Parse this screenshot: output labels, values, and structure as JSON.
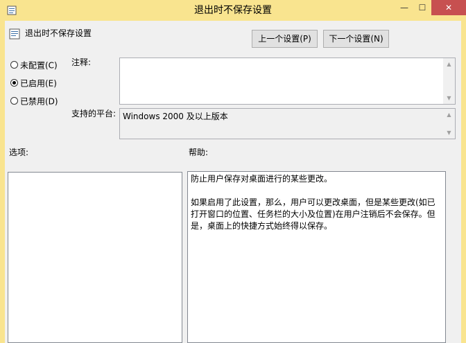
{
  "window": {
    "title": "退出时不保存设置",
    "minimize_glyph": "—",
    "maximize_glyph": "☐",
    "close_glyph": "✕"
  },
  "header": {
    "setting_title": "退出时不保存设置",
    "prev_button": "上一个设置(P)",
    "next_button": "下一个设置(N)"
  },
  "state": {
    "options": [
      {
        "label": "未配置(C)",
        "checked": false
      },
      {
        "label": "已启用(E)",
        "checked": true
      },
      {
        "label": "已禁用(D)",
        "checked": false
      }
    ]
  },
  "comment": {
    "label": "注释:",
    "value": ""
  },
  "supported": {
    "label": "支持的平台:",
    "value": "Windows 2000 及以上版本"
  },
  "options_pane": {
    "label": "选项:"
  },
  "help_pane": {
    "label": "帮助:",
    "paragraphs": [
      "防止用户保存对桌面进行的某些更改。",
      "如果启用了此设置，那么，用户可以更改桌面，但是某些更改(如已打开窗口的位置、任务栏的大小及位置)在用户注销后不会保存。但是，桌面上的快捷方式始终得以保存。"
    ]
  },
  "colors": {
    "frame": "#f9e48f",
    "close_button": "#c75050"
  }
}
